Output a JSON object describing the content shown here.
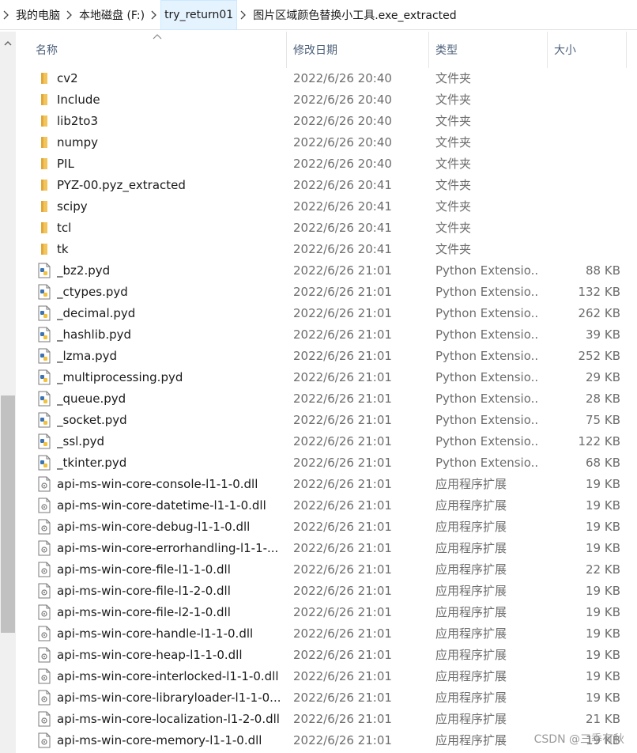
{
  "breadcrumb": [
    "我的电脑",
    "本地磁盘 (F:)",
    "try_return01",
    "图片区域颜色替换小工具.exe_extracted"
  ],
  "columns": {
    "name": "名称",
    "date": "修改日期",
    "type": "类型",
    "size": "大小"
  },
  "files": [
    {
      "name": "cv2",
      "date": "2022/6/26 20:40",
      "type": "文件夹",
      "size": "",
      "icon": "folder-icon"
    },
    {
      "name": "Include",
      "date": "2022/6/26 20:40",
      "type": "文件夹",
      "size": "",
      "icon": "folder-icon"
    },
    {
      "name": "lib2to3",
      "date": "2022/6/26 20:40",
      "type": "文件夹",
      "size": "",
      "icon": "folder-icon"
    },
    {
      "name": "numpy",
      "date": "2022/6/26 20:40",
      "type": "文件夹",
      "size": "",
      "icon": "folder-icon"
    },
    {
      "name": "PIL",
      "date": "2022/6/26 20:40",
      "type": "文件夹",
      "size": "",
      "icon": "folder-icon"
    },
    {
      "name": "PYZ-00.pyz_extracted",
      "date": "2022/6/26 20:41",
      "type": "文件夹",
      "size": "",
      "icon": "folder-icon"
    },
    {
      "name": "scipy",
      "date": "2022/6/26 20:41",
      "type": "文件夹",
      "size": "",
      "icon": "folder-icon"
    },
    {
      "name": "tcl",
      "date": "2022/6/26 20:41",
      "type": "文件夹",
      "size": "",
      "icon": "folder-icon"
    },
    {
      "name": "tk",
      "date": "2022/6/26 20:41",
      "type": "文件夹",
      "size": "",
      "icon": "folder-icon"
    },
    {
      "name": "_bz2.pyd",
      "date": "2022/6/26 21:01",
      "type": "Python Extensio...",
      "size": "88 KB",
      "icon": "python-file-icon"
    },
    {
      "name": "_ctypes.pyd",
      "date": "2022/6/26 21:01",
      "type": "Python Extensio...",
      "size": "132 KB",
      "icon": "python-file-icon"
    },
    {
      "name": "_decimal.pyd",
      "date": "2022/6/26 21:01",
      "type": "Python Extensio...",
      "size": "262 KB",
      "icon": "python-file-icon"
    },
    {
      "name": "_hashlib.pyd",
      "date": "2022/6/26 21:01",
      "type": "Python Extensio...",
      "size": "39 KB",
      "icon": "python-file-icon"
    },
    {
      "name": "_lzma.pyd",
      "date": "2022/6/26 21:01",
      "type": "Python Extensio...",
      "size": "252 KB",
      "icon": "python-file-icon"
    },
    {
      "name": "_multiprocessing.pyd",
      "date": "2022/6/26 21:01",
      "type": "Python Extensio...",
      "size": "29 KB",
      "icon": "python-file-icon"
    },
    {
      "name": "_queue.pyd",
      "date": "2022/6/26 21:01",
      "type": "Python Extensio...",
      "size": "28 KB",
      "icon": "python-file-icon"
    },
    {
      "name": "_socket.pyd",
      "date": "2022/6/26 21:01",
      "type": "Python Extensio...",
      "size": "75 KB",
      "icon": "python-file-icon"
    },
    {
      "name": "_ssl.pyd",
      "date": "2022/6/26 21:01",
      "type": "Python Extensio...",
      "size": "122 KB",
      "icon": "python-file-icon"
    },
    {
      "name": "_tkinter.pyd",
      "date": "2022/6/26 21:01",
      "type": "Python Extensio...",
      "size": "68 KB",
      "icon": "python-file-icon"
    },
    {
      "name": "api-ms-win-core-console-l1-1-0.dll",
      "date": "2022/6/26 21:01",
      "type": "应用程序扩展",
      "size": "19 KB",
      "icon": "dll-file-icon"
    },
    {
      "name": "api-ms-win-core-datetime-l1-1-0.dll",
      "date": "2022/6/26 21:01",
      "type": "应用程序扩展",
      "size": "19 KB",
      "icon": "dll-file-icon"
    },
    {
      "name": "api-ms-win-core-debug-l1-1-0.dll",
      "date": "2022/6/26 21:01",
      "type": "应用程序扩展",
      "size": "19 KB",
      "icon": "dll-file-icon"
    },
    {
      "name": "api-ms-win-core-errorhandling-l1-1-...",
      "date": "2022/6/26 21:01",
      "type": "应用程序扩展",
      "size": "19 KB",
      "icon": "dll-file-icon"
    },
    {
      "name": "api-ms-win-core-file-l1-1-0.dll",
      "date": "2022/6/26 21:01",
      "type": "应用程序扩展",
      "size": "22 KB",
      "icon": "dll-file-icon"
    },
    {
      "name": "api-ms-win-core-file-l1-2-0.dll",
      "date": "2022/6/26 21:01",
      "type": "应用程序扩展",
      "size": "19 KB",
      "icon": "dll-file-icon"
    },
    {
      "name": "api-ms-win-core-file-l2-1-0.dll",
      "date": "2022/6/26 21:01",
      "type": "应用程序扩展",
      "size": "19 KB",
      "icon": "dll-file-icon"
    },
    {
      "name": "api-ms-win-core-handle-l1-1-0.dll",
      "date": "2022/6/26 21:01",
      "type": "应用程序扩展",
      "size": "19 KB",
      "icon": "dll-file-icon"
    },
    {
      "name": "api-ms-win-core-heap-l1-1-0.dll",
      "date": "2022/6/26 21:01",
      "type": "应用程序扩展",
      "size": "19 KB",
      "icon": "dll-file-icon"
    },
    {
      "name": "api-ms-win-core-interlocked-l1-1-0.dll",
      "date": "2022/6/26 21:01",
      "type": "应用程序扩展",
      "size": "19 KB",
      "icon": "dll-file-icon"
    },
    {
      "name": "api-ms-win-core-libraryloader-l1-1-0...",
      "date": "2022/6/26 21:01",
      "type": "应用程序扩展",
      "size": "19 KB",
      "icon": "dll-file-icon"
    },
    {
      "name": "api-ms-win-core-localization-l1-2-0.dll",
      "date": "2022/6/26 21:01",
      "type": "应用程序扩展",
      "size": "21 KB",
      "icon": "dll-file-icon"
    },
    {
      "name": "api-ms-win-core-memory-l1-1-0.dll",
      "date": "2022/6/26 21:01",
      "type": "应用程序扩展",
      "size": "19 KB",
      "icon": "dll-file-icon"
    }
  ],
  "watermark": "CSDN @三季有秋",
  "colors": {
    "folder": "#f2c55c",
    "header_text": "#4c607a",
    "meta_text": "#6d6d6d",
    "active_crumb_bg": "#e5f3ff"
  }
}
